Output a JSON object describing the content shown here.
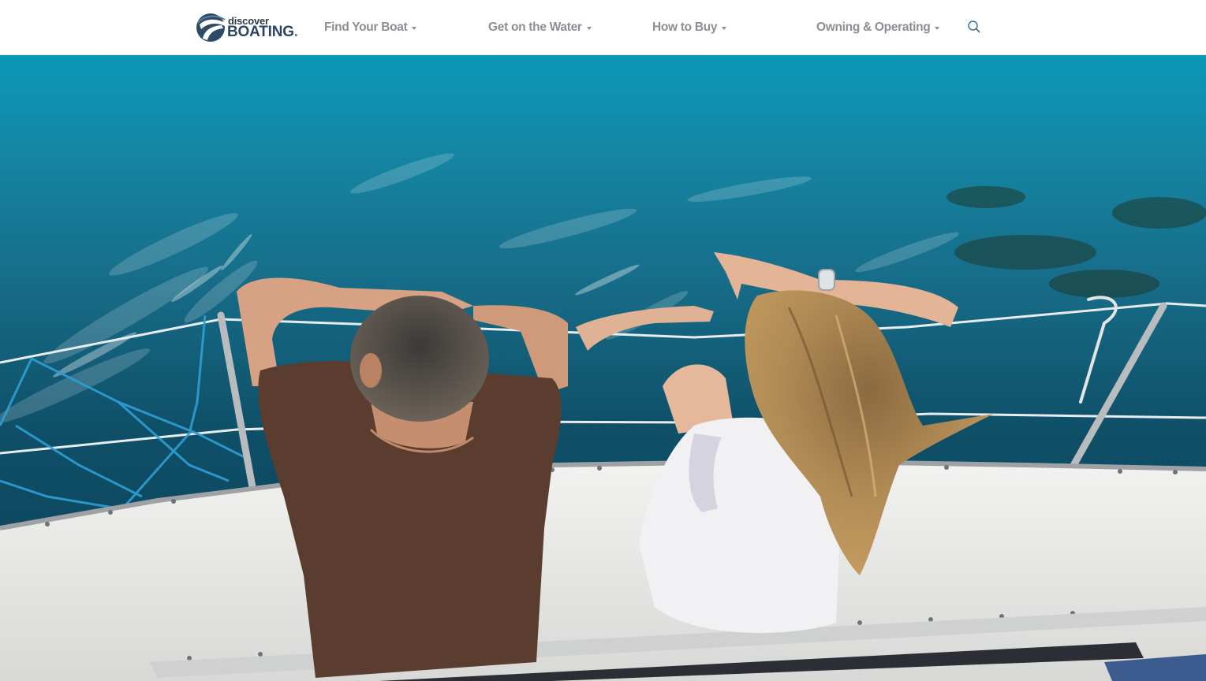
{
  "brand": {
    "logo_line1": "discover",
    "logo_line2": "BOATING",
    "logo_suffix": "."
  },
  "nav": {
    "items": [
      {
        "label": "Find Your Boat",
        "has_dropdown": true
      },
      {
        "label": "Get on the Water",
        "has_dropdown": true
      },
      {
        "label": "How to Buy",
        "has_dropdown": true
      },
      {
        "label": "Owning & Operating",
        "has_dropdown": true
      }
    ],
    "search_icon": "search-icon"
  },
  "colors": {
    "nav_text": "#8a8f96",
    "logo_text": "#2c4560",
    "water_top": "#0e93b4",
    "water_deep": "#0d4a66",
    "deck": "#e8e8e6"
  }
}
